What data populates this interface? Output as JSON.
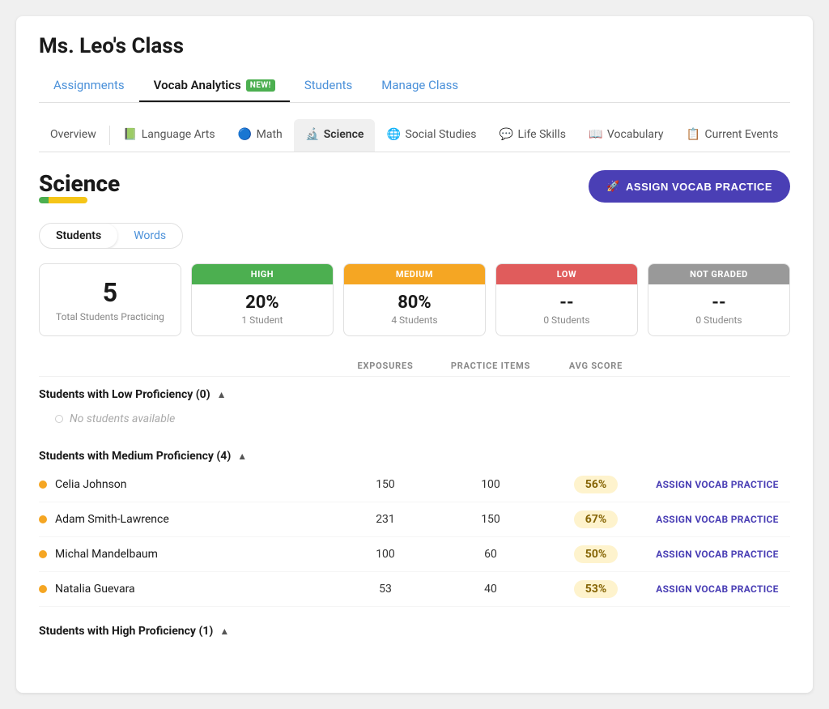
{
  "page": {
    "title": "Ms. Leo's Class",
    "main_tabs": [
      {
        "id": "assignments",
        "label": "Assignments",
        "active": false
      },
      {
        "id": "vocab-analytics",
        "label": "Vocab Analytics",
        "active": true,
        "badge": "NEW!"
      },
      {
        "id": "students",
        "label": "Students",
        "active": false
      },
      {
        "id": "manage-class",
        "label": "Manage Class",
        "active": false
      }
    ],
    "subject_tabs": [
      {
        "id": "overview",
        "label": "Overview",
        "icon": "",
        "active": false
      },
      {
        "id": "language-arts",
        "label": "Language Arts",
        "icon": "📗",
        "active": false
      },
      {
        "id": "math",
        "label": "Math",
        "icon": "🔵",
        "active": false
      },
      {
        "id": "science",
        "label": "Science",
        "icon": "🔬",
        "active": true
      },
      {
        "id": "social-studies",
        "label": "Social Studies",
        "icon": "🌐",
        "active": false
      },
      {
        "id": "life-skills",
        "label": "Life Skills",
        "icon": "💬",
        "active": false
      },
      {
        "id": "vocabulary",
        "label": "Vocabulary",
        "icon": "📖",
        "active": false
      },
      {
        "id": "current-events",
        "label": "Current Events",
        "icon": "📋",
        "active": false
      }
    ],
    "active_subject": "Science",
    "assign_button_label": "ASSIGN VOCAB PRACTICE",
    "sub_tabs": [
      {
        "id": "students",
        "label": "Students",
        "active": true
      },
      {
        "id": "words",
        "label": "Words",
        "active": false
      }
    ],
    "total_students": {
      "count": "5",
      "label": "Total Students Practicing"
    },
    "proficiency_cards": [
      {
        "level": "HIGH",
        "class": "high",
        "pct": "20%",
        "count": "1 Student"
      },
      {
        "level": "MEDIUM",
        "class": "medium",
        "pct": "80%",
        "count": "4 Students"
      },
      {
        "level": "LOW",
        "class": "low",
        "pct": "--",
        "count": "0 Students"
      },
      {
        "level": "NOT GRADED",
        "class": "not-graded",
        "pct": "--",
        "count": "0 Students"
      }
    ],
    "table_headers": {
      "name": "",
      "exposures": "EXPOSURES",
      "practice_items": "PRACTICE ITEMS",
      "avg_score": "AVG SCORE",
      "action": ""
    },
    "groups": [
      {
        "id": "low",
        "title": "Students with Low Proficiency (0)",
        "expanded": true,
        "no_students": true,
        "no_students_label": "No students available",
        "students": []
      },
      {
        "id": "medium",
        "title": "Students with Medium Proficiency (4)",
        "expanded": true,
        "no_students": false,
        "students": [
          {
            "name": "Celia Johnson",
            "exposures": "150",
            "practice_items": "100",
            "avg_score": "56%",
            "action": "ASSIGN VOCAB PRACTICE"
          },
          {
            "name": "Adam Smith-Lawrence",
            "exposures": "231",
            "practice_items": "150",
            "avg_score": "67%",
            "action": "ASSIGN VOCAB PRACTICE"
          },
          {
            "name": "Michal Mandelbaum",
            "exposures": "100",
            "practice_items": "60",
            "avg_score": "50%",
            "action": "ASSIGN VOCAB PRACTICE"
          },
          {
            "name": "Natalia Guevara",
            "exposures": "53",
            "practice_items": "40",
            "avg_score": "53%",
            "action": "ASSIGN VOCAB PRACTICE"
          }
        ]
      },
      {
        "id": "high",
        "title": "Students with High Proficiency (1)",
        "expanded": true,
        "no_students": false,
        "students": []
      }
    ]
  }
}
